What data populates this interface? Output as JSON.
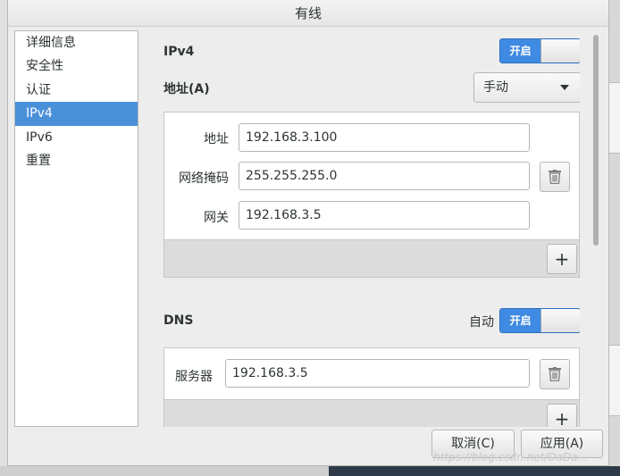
{
  "window": {
    "title": "有线"
  },
  "sidebar": {
    "items": [
      {
        "label": "详细信息",
        "selected": false
      },
      {
        "label": "安全性",
        "selected": false
      },
      {
        "label": "认证",
        "selected": false
      },
      {
        "label": "IPv4",
        "selected": true
      },
      {
        "label": "IPv6",
        "selected": false
      },
      {
        "label": "重置",
        "selected": false
      }
    ]
  },
  "ipv4": {
    "heading": "IPv4",
    "switch_label": "开启",
    "address_heading": "地址(A)",
    "method": "手动",
    "fields": {
      "address_label": "地址",
      "address_value": "192.168.3.100",
      "netmask_label": "网络掩码",
      "netmask_value": "255.255.255.0",
      "gateway_label": "网关",
      "gateway_value": "192.168.3.5"
    },
    "add_symbol": "+"
  },
  "dns": {
    "heading": "DNS",
    "auto_label": "自动",
    "switch_label": "开启",
    "server_label": "服务器",
    "server_value": "192.168.3.5",
    "add_symbol": "+"
  },
  "buttons": {
    "cancel": "取消(C)",
    "apply": "应用(A)"
  },
  "watermark": "https://blog.csdn.net/DaDa..."
}
